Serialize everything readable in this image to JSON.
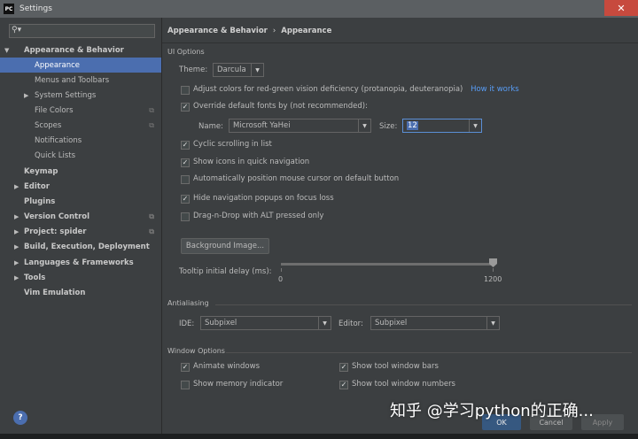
{
  "window": {
    "title": "Settings",
    "app_icon": "PC",
    "close_label": "✕"
  },
  "sidebar": {
    "search_placeholder": "",
    "items": [
      {
        "label": "Appearance & Behavior",
        "bold": true,
        "expanded": true
      },
      {
        "label": "Appearance",
        "selected": true
      },
      {
        "label": "Menus and Toolbars"
      },
      {
        "label": "System Settings",
        "collapsed": true
      },
      {
        "label": "File Colors"
      },
      {
        "label": "Scopes"
      },
      {
        "label": "Notifications"
      },
      {
        "label": "Quick Lists"
      },
      {
        "label": "Keymap",
        "bold": true
      },
      {
        "label": "Editor",
        "bold": true
      },
      {
        "label": "Plugins",
        "bold": true
      },
      {
        "label": "Version Control",
        "bold": true
      },
      {
        "label": "Project: spider",
        "bold": true
      },
      {
        "label": "Build, Execution, Deployment",
        "bold": true
      },
      {
        "label": "Languages & Frameworks",
        "bold": true
      },
      {
        "label": "Tools",
        "bold": true
      },
      {
        "label": "Vim Emulation",
        "bold": true
      }
    ],
    "help_label": "?"
  },
  "breadcrumb": {
    "parent": "Appearance & Behavior",
    "sep": "›",
    "current": "Appearance"
  },
  "ui_options": {
    "section": "UI Options",
    "theme_label": "Theme:",
    "theme_value": "Darcula",
    "adjust_colors": {
      "label": "Adjust colors for red-green vision deficiency (protanopia, deuteranopia)",
      "checked": false
    },
    "how_it_works": "How it works",
    "override_fonts": {
      "label": "Override default fonts by (not recommended):",
      "checked": true
    },
    "name_label": "Name:",
    "name_value": "Microsoft YaHei",
    "size_label": "Size:",
    "size_value": "12",
    "cyclic": {
      "label": "Cyclic scrolling in list",
      "checked": true
    },
    "show_icons": {
      "label": "Show icons in quick navigation",
      "checked": true
    },
    "auto_position": {
      "label": "Automatically position mouse cursor on default button",
      "checked": false
    },
    "hide_popups": {
      "label": "Hide navigation popups on focus loss",
      "checked": true
    },
    "drag_drop": {
      "label": "Drag-n-Drop with ALT pressed only",
      "checked": false
    },
    "background_button": "Background Image...",
    "tooltip_label": "Tooltip initial delay (ms):",
    "tooltip_min": "0",
    "tooltip_max": "1200",
    "tooltip_value": 1200
  },
  "antialiasing": {
    "section": "Antialiasing",
    "ide_label": "IDE:",
    "ide_value": "Subpixel",
    "editor_label": "Editor:",
    "editor_value": "Subpixel"
  },
  "window_options": {
    "section": "Window Options",
    "animate": {
      "label": "Animate windows",
      "checked": true
    },
    "memory": {
      "label": "Show memory indicator",
      "checked": false
    },
    "tool_bars": {
      "label": "Show tool window bars",
      "checked": true
    },
    "tool_numbers": {
      "label": "Show tool window numbers",
      "checked": true
    }
  },
  "dialog": {
    "ok": "OK",
    "cancel": "Cancel",
    "apply": "Apply"
  },
  "watermark": "知乎 @学习python的正确..."
}
